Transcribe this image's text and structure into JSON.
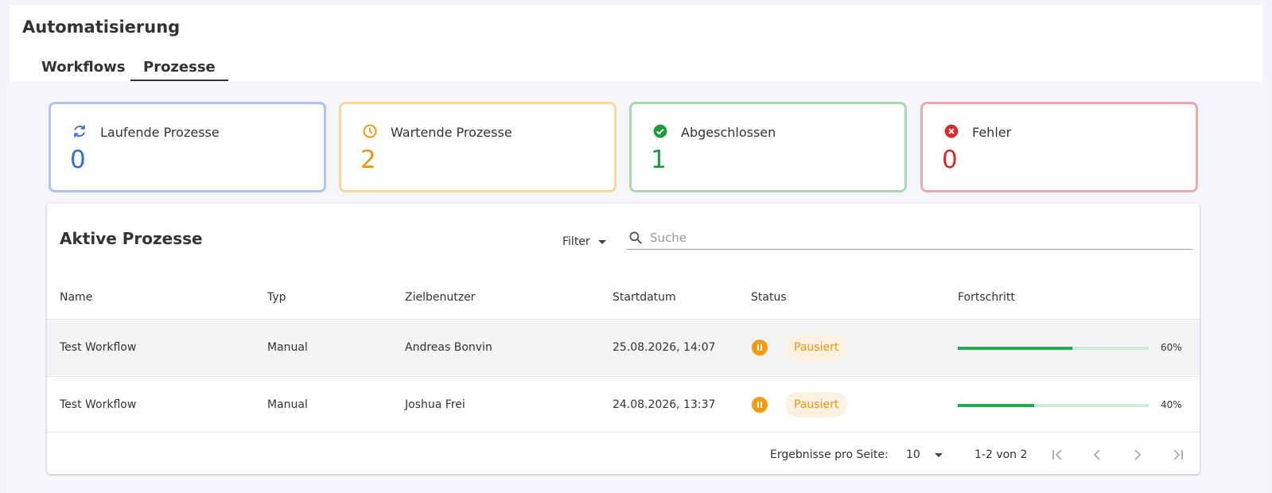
{
  "header": {
    "title": "Automatisierung",
    "tabs": [
      {
        "label": "Workflows",
        "active": false
      },
      {
        "label": "Prozesse",
        "active": true
      }
    ]
  },
  "stats": [
    {
      "label": "Laufende Prozesse",
      "value": "0",
      "icon": "refresh-icon",
      "color": "#2f6fd9"
    },
    {
      "label": "Wartende Prozesse",
      "value": "2",
      "icon": "clock-icon",
      "color": "#f0950a"
    },
    {
      "label": "Abgeschlossen",
      "value": "1",
      "icon": "check-circle-icon",
      "color": "#1e9a3c"
    },
    {
      "label": "Fehler",
      "value": "0",
      "icon": "error-circle-icon",
      "color": "#d92b2b"
    }
  ],
  "panel": {
    "title": "Aktive Prozesse",
    "filter_label": "Filter",
    "search_placeholder": "Suche"
  },
  "table": {
    "columns": [
      "Name",
      "Typ",
      "Zielbenutzer",
      "Startdatum",
      "Status",
      "Fortschritt"
    ],
    "rows": [
      {
        "name": "Test Workflow",
        "typ": "Manual",
        "user": "Andreas Bonvin",
        "date": "25.08.2026, 14:07",
        "status": "Pausiert",
        "progress": 60,
        "progress_label": "60%"
      },
      {
        "name": "Test Workflow",
        "typ": "Manual",
        "user": "Joshua Frei",
        "date": "24.08.2026, 13:37",
        "status": "Pausiert",
        "progress": 40,
        "progress_label": "40%"
      }
    ]
  },
  "pagination": {
    "per_page_label": "Ergebnisse pro Seite:",
    "per_page": "10",
    "range": "1-2 von 2"
  }
}
